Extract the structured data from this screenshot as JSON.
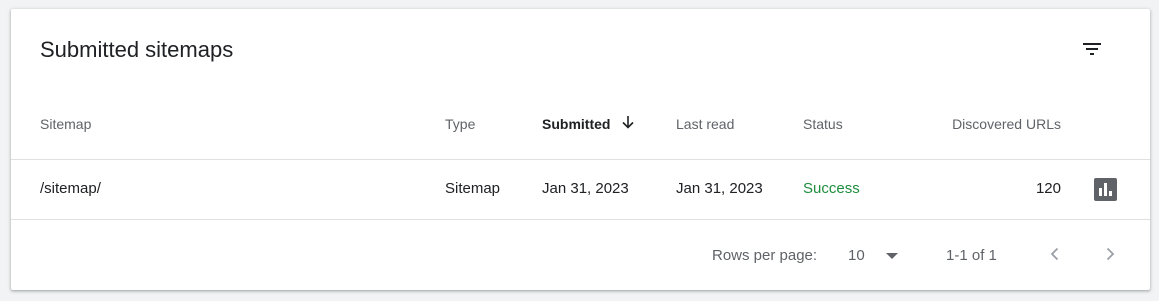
{
  "card": {
    "title": "Submitted sitemaps"
  },
  "table": {
    "columns": {
      "sitemap": "Sitemap",
      "type": "Type",
      "submitted": "Submitted",
      "last_read": "Last read",
      "status": "Status",
      "discovered_urls": "Discovered URLs"
    },
    "sort": {
      "column": "Submitted",
      "direction": "descending"
    },
    "rows": [
      {
        "sitemap": "/sitemap/",
        "type": "Sitemap",
        "submitted": "Jan 31, 2023",
        "last_read": "Jan 31, 2023",
        "status": "Success",
        "discovered_urls": "120"
      }
    ]
  },
  "pagination": {
    "rows_per_page_label": "Rows per page:",
    "rows_per_page_value": "10",
    "range": "1-1 of 1"
  },
  "colors": {
    "success": "#1e8e3e",
    "text_primary": "#202124",
    "text_secondary": "#5f6368",
    "divider": "#e0e0e0"
  },
  "icons": {
    "filter": "filter-list-icon",
    "sort": "arrow-downward-icon",
    "report": "bar-chart-icon",
    "dropdown": "arrow-drop-down-icon",
    "prev": "chevron-left-icon",
    "next": "chevron-right-icon"
  }
}
